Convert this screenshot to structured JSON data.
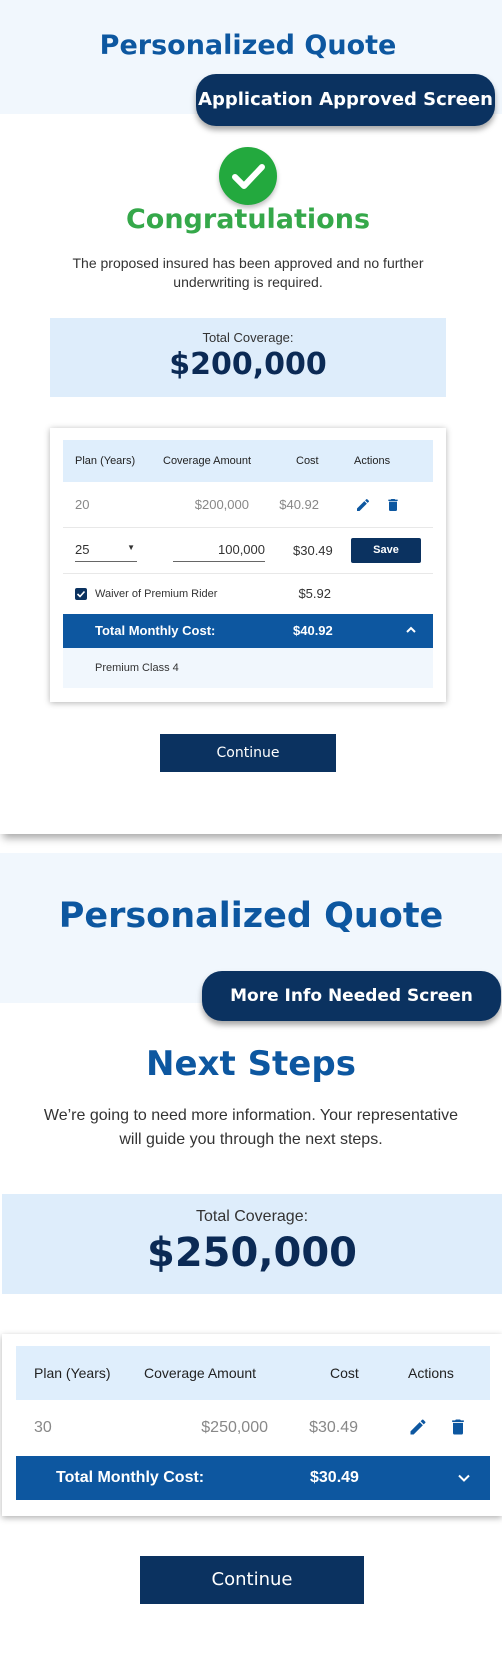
{
  "approved_screen": {
    "title": "Personalized Quote",
    "screen_label": "Application Approved Screen",
    "heading": "Congratulations",
    "message": "The proposed insured has been approved and no further underwriting is required.",
    "total_coverage_label": "Total Coverage:",
    "total_coverage_amount": "$200,000",
    "table": {
      "headers": [
        "Plan (Years)",
        "Coverage Amount",
        "Cost",
        "Actions"
      ],
      "rows": [
        {
          "plan": "20",
          "coverage": "$200,000",
          "cost": "$40.92"
        }
      ],
      "edit_row": {
        "plan_selected": "25",
        "coverage_value": "100,000",
        "cost": "$30.49",
        "save_label": "Save"
      },
      "rider": {
        "label": "Waiver of Premium Rider",
        "cost": "$5.92",
        "checked": true
      },
      "total": {
        "label": "Total Monthly Cost:",
        "amount": "$40.92"
      },
      "premium_class": "Premium Class 4"
    },
    "continue_label": "Continue"
  },
  "more_info_screen": {
    "title": "Personalized Quote",
    "screen_label": "More Info Needed Screen",
    "heading": "Next Steps",
    "message": "We’re going to need more information. Your representative will guide you through the next steps.",
    "total_coverage_label": "Total Coverage:",
    "total_coverage_amount": "$250,000",
    "table": {
      "headers": [
        "Plan (Years)",
        "Coverage Amount",
        "Cost",
        "Actions"
      ],
      "rows": [
        {
          "plan": "30",
          "coverage": "$250,000",
          "cost": "$30.49"
        }
      ],
      "total": {
        "label": "Total Monthly Cost:",
        "amount": "$30.49"
      }
    },
    "continue_label": "Continue"
  },
  "colors": {
    "primary_blue": "#0d57a0",
    "navy": "#0b3260",
    "success_green": "#23a93e",
    "light_blue_bg": "#deedfb"
  },
  "icons": [
    "checkmark-icon",
    "edit-pencil-icon",
    "trash-icon",
    "chevron-up-icon",
    "chevron-down-icon",
    "dropdown-arrow-icon",
    "checkbox-checked-icon"
  ]
}
